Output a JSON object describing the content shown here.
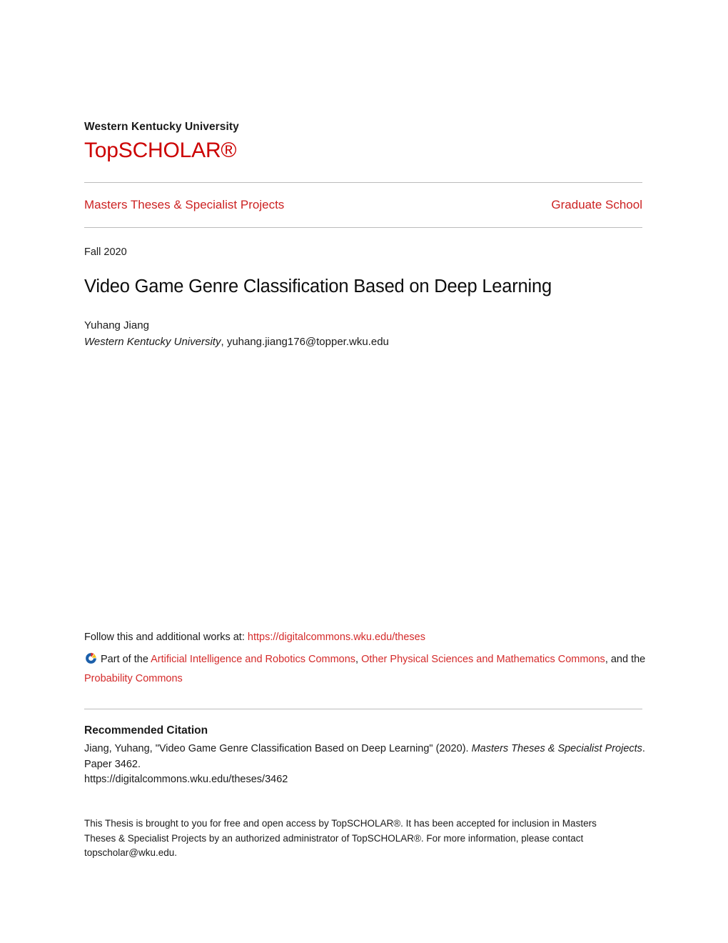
{
  "header": {
    "institution": "Western Kentucky University",
    "brand": "TopSCHOLAR®"
  },
  "series": {
    "name": "Masters Theses & Specialist Projects",
    "owner": "Graduate School"
  },
  "article": {
    "date": "Fall 2020",
    "title": "Video Game Genre Classification Based on Deep Learning",
    "author_name": "Yuhang Jiang",
    "author_affiliation": "Western Kentucky University",
    "author_separator": ", ",
    "author_email": "yuhang.jiang176@topper.wku.edu"
  },
  "follow": {
    "prefix": "Follow this and additional works at: ",
    "url": "https://digitalcommons.wku.edu/theses",
    "icon": "digital-commons-network-icon",
    "part_of_prefix": "Part of the ",
    "commons": [
      {
        "label": "Artificial Intelligence and Robotics Commons",
        "after": ", "
      },
      {
        "label": "Other Physical Sciences and Mathematics Commons",
        "after": ", and the "
      },
      {
        "label": "Probability Commons",
        "after": ""
      }
    ]
  },
  "citation": {
    "heading": "Recommended Citation",
    "text_before": "Jiang, Yuhang, \"Video Game Genre Classification Based on Deep Learning\" (2020). ",
    "series_italic": "Masters Theses & Specialist Projects",
    "text_after": ". Paper 3462.",
    "url": "https://digitalcommons.wku.edu/theses/3462"
  },
  "footer": {
    "note": "This Thesis is brought to you for free and open access by TopSCHOLAR®. It has been accepted for inclusion in Masters Theses & Specialist Projects by an authorized administrator of TopSCHOLAR®. For more information, please contact topscholar@wku.edu."
  },
  "colors": {
    "brand_red": "#cc0000",
    "link_red": "#d42a2a",
    "rule_gray": "#bcbcbc",
    "text_black": "#1a1a1a",
    "icon_blue": "#1b5faa",
    "icon_red": "#e03127",
    "icon_yellow": "#f5c518"
  }
}
